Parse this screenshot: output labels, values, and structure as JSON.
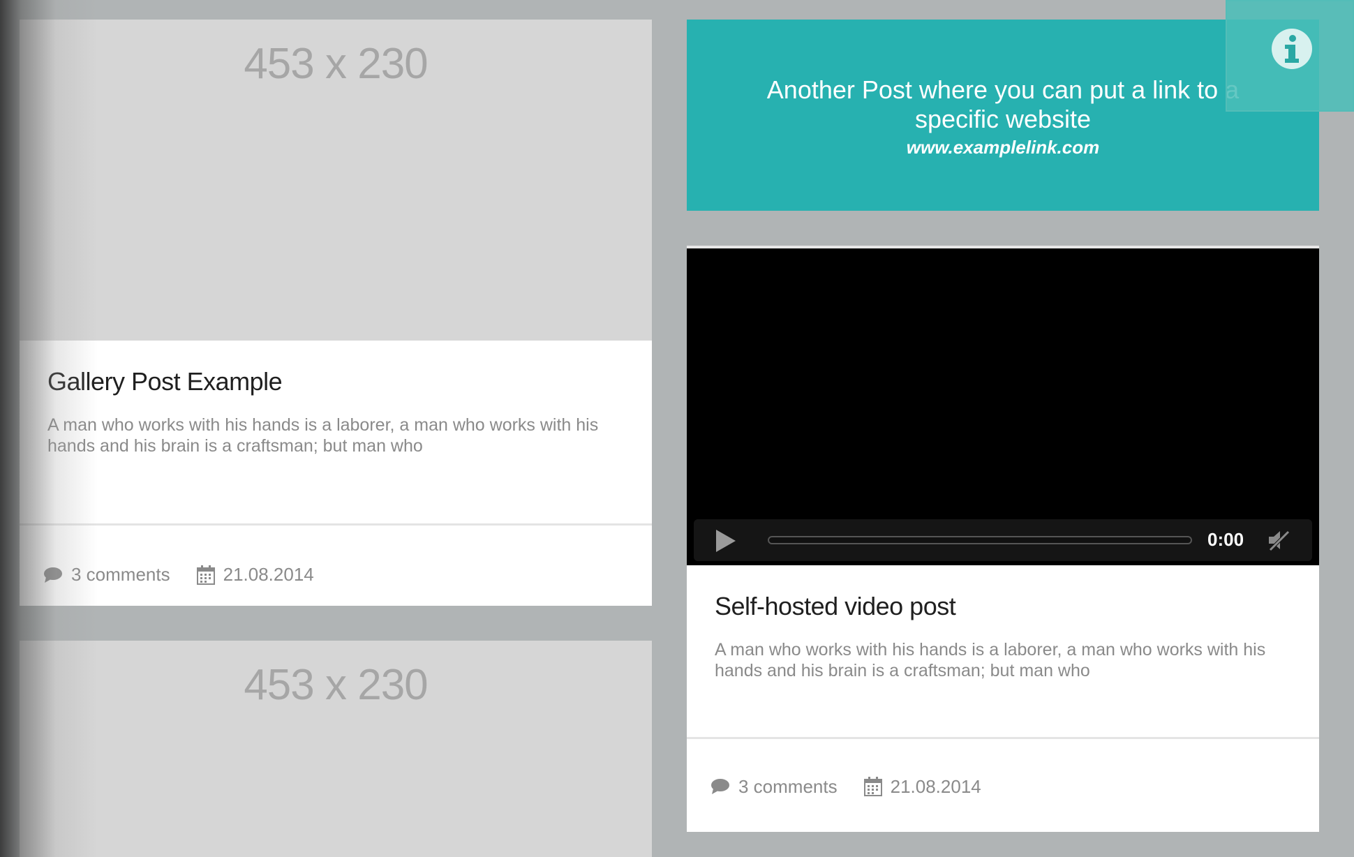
{
  "posts": {
    "gallery": {
      "placeholder": "453 x 230",
      "title": "Gallery Post Example",
      "excerpt": "A man who works with his hands is a laborer, a man who works with his hands and his brain is a craftsman; but man who",
      "comments": "3 comments",
      "date": "21.08.2014"
    },
    "gallery_second": {
      "placeholder": "453 x 230"
    },
    "link": {
      "text": "Another Post where you can put a link to a specific website",
      "url": "www.examplelink.com"
    },
    "video": {
      "time": "0:00",
      "title": "Self-hosted video post",
      "excerpt": "A man who works with his hands is a laborer, a man who works with his hands and his brain is a craftsman; but man who",
      "comments": "3 comments",
      "date": "21.08.2014"
    }
  },
  "colors": {
    "background": "#b0b4b5",
    "accent": "#27b1b0",
    "placeholder": "#d6d6d6"
  },
  "icons": [
    "comment-icon",
    "calendar-icon",
    "info-icon",
    "play-icon",
    "mute-icon"
  ]
}
